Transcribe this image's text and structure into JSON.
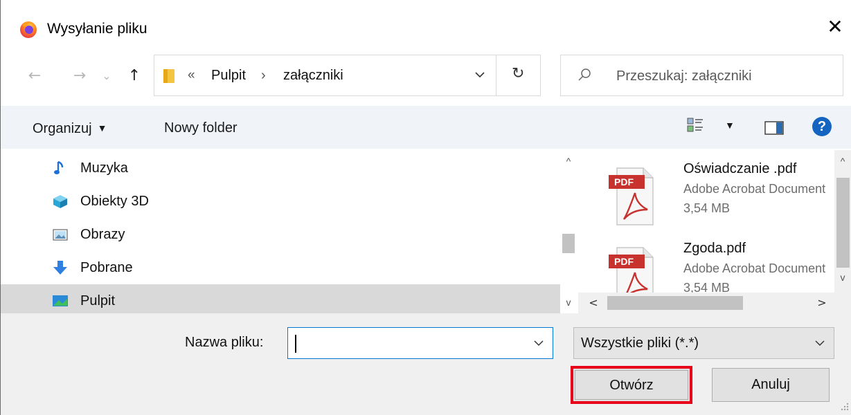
{
  "window": {
    "title": "Wysyłanie pliku",
    "close_glyph": "✕"
  },
  "navigation": {
    "back_glyph": "←",
    "forward_glyph": "→",
    "recent_glyph": "⌄",
    "up_glyph": "↑",
    "breadcrumb_overflow": "«",
    "breadcrumb": [
      "Pulpit",
      "załączniki"
    ],
    "separator": "›",
    "refresh_glyph": "↻"
  },
  "search": {
    "placeholder": "Przeszukaj: załączniki"
  },
  "toolbar": {
    "organize_label": "Organizuj",
    "organize_caret": "▼",
    "new_folder_label": "Nowy folder",
    "view_caret": "▼",
    "help_label": "?"
  },
  "sidebar": {
    "items": [
      {
        "label": "Muzyka",
        "icon": "music-note-icon"
      },
      {
        "label": "Obiekty 3D",
        "icon": "cube-3d-icon"
      },
      {
        "label": "Obrazy",
        "icon": "pictures-icon"
      },
      {
        "label": "Pobrane",
        "icon": "download-arrow-icon"
      },
      {
        "label": "Pulpit",
        "icon": "desktop-icon",
        "selected": true
      }
    ]
  },
  "files": [
    {
      "name": "Oświadczanie .pdf",
      "type": "Adobe Acrobat Document",
      "size": "3,54 MB",
      "icon_label": "PDF"
    },
    {
      "name": "Zgoda.pdf",
      "type": "Adobe Acrobat Document",
      "size": "3,54 MB",
      "icon_label": "PDF"
    }
  ],
  "scroll_glyphs": {
    "up": "^",
    "down": "v",
    "left": "<",
    "right": ">"
  },
  "bottom": {
    "filename_label": "Nazwa pliku:",
    "filename_value": "",
    "filetype_value": "Wszystkie pliki (*.*)",
    "open_label": "Otwórz",
    "cancel_label": "Anuluj"
  },
  "colors": {
    "highlight_border": "#e8001a",
    "selection_bg": "#d9d9d9",
    "toolbar_bg": "#f0f4f9",
    "help_blue": "#1565c0"
  }
}
